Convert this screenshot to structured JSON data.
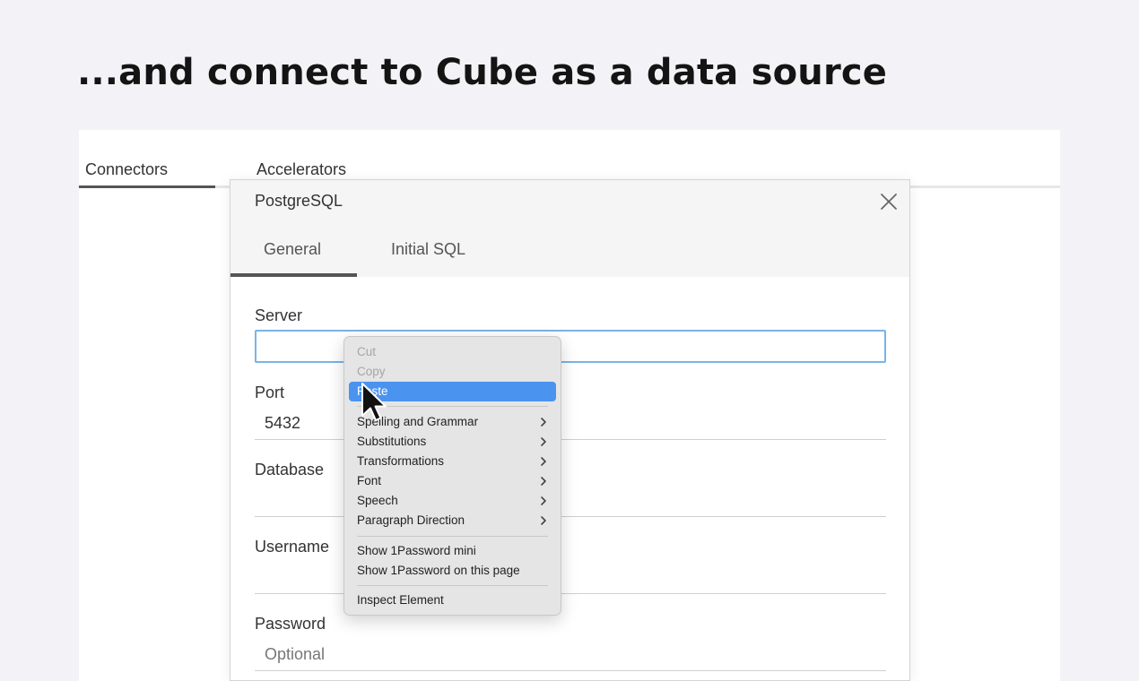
{
  "headline": "...and connect to Cube as a data source",
  "app": {
    "tabs": [
      "Connectors",
      "Accelerators"
    ]
  },
  "dialog": {
    "title": "PostgreSQL",
    "tabs": [
      "General",
      "Initial SQL"
    ],
    "fields": {
      "server": {
        "label": "Server",
        "value": ""
      },
      "port": {
        "label": "Port",
        "value": "5432"
      },
      "database": {
        "label": "Database",
        "value": ""
      },
      "username": {
        "label": "Username",
        "value": ""
      },
      "password": {
        "label": "Password",
        "placeholder": "Optional"
      }
    }
  },
  "context_menu": {
    "items": [
      {
        "label": "Cut",
        "disabled": true
      },
      {
        "label": "Copy",
        "disabled": true
      },
      {
        "label": "Paste",
        "highlighted": true
      },
      {
        "label": "Spelling and Grammar",
        "submenu": true
      },
      {
        "label": "Substitutions",
        "submenu": true
      },
      {
        "label": "Transformations",
        "submenu": true
      },
      {
        "label": "Font",
        "submenu": true
      },
      {
        "label": "Speech",
        "submenu": true
      },
      {
        "label": "Paragraph Direction",
        "submenu": true
      },
      {
        "label": "Show 1Password mini"
      },
      {
        "label": "Show 1Password on this page"
      },
      {
        "label": "Inspect Element"
      }
    ]
  },
  "colors": {
    "accent_highlight": "#4a93ef",
    "input_focus_border": "#7ab3e6"
  }
}
